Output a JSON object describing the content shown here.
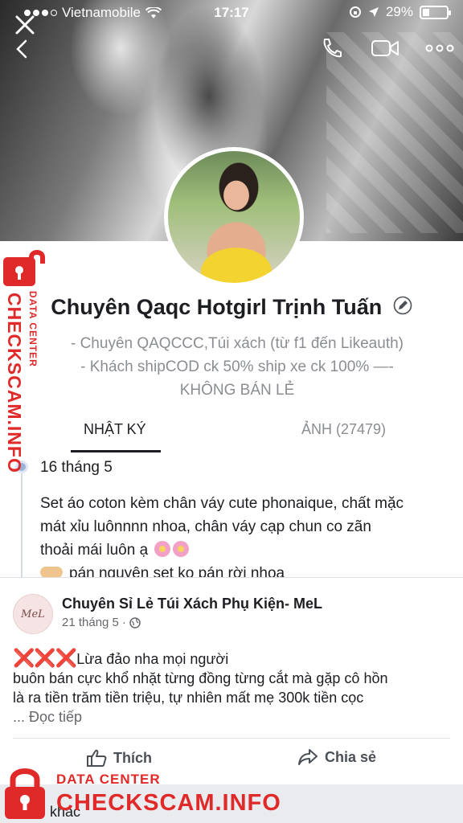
{
  "status": {
    "carrier": "Vietnamobile",
    "time": "17:17",
    "battery": "29%",
    "battery_level": 0.29
  },
  "nav": {
    "close_icon": "close-icon",
    "back_icon": "chevron-left-icon",
    "call_icon": "phone-icon",
    "video_icon": "video-icon",
    "more_icon": "more-icon"
  },
  "profile": {
    "name": "Chuyên Qaqc Hotgirl Trịnh Tuấn",
    "bio_line1": "- Chuyên QAQCCC,Túi xách (từ f1 đến Likeauth)",
    "bio_line2": "- Khách shipCOD ck 50% ship xe ck 100% —-",
    "bio_line3": "KHÔNG BÁN LẺ"
  },
  "tabs": {
    "diary": "NHẬT KÝ",
    "photos": "ẢNH (27479)"
  },
  "diary": {
    "date": "16 tháng 5",
    "line1": "Set áo coton kèm chân váy cute phonaique, chất mặc",
    "line2": "mát xỉu luônnnn nhoa, chân váy cạp chun co zãn",
    "line3": "thoải mái luôn ạ",
    "line4": "pán nguyên set ko pán rời nhoa"
  },
  "post": {
    "avatar_text": "MeL",
    "author": "Chuyên Sỉ Lẻ Túi Xách Phụ Kiện- MeL",
    "date": "21 tháng 5",
    "dot": "·",
    "marks": "❌❌❌",
    "line1": "Lừa đảo nha mọi người",
    "line2": "buôn bán cực khổ nhặt từng đồng từng cắt mà gặp cô hồn",
    "line3": "là ra tiền trăm tiền triệu, tự nhiên mất mẹ 300k tiền cọc",
    "read_more": "... Đọc tiếp",
    "like": "Thích",
    "share": "Chia sẻ"
  },
  "footer": {
    "other": "khác"
  },
  "watermark": {
    "top": "DATA CENTER",
    "brand": "CHECKSCAM.INFO",
    "color": "#e02a2a"
  }
}
